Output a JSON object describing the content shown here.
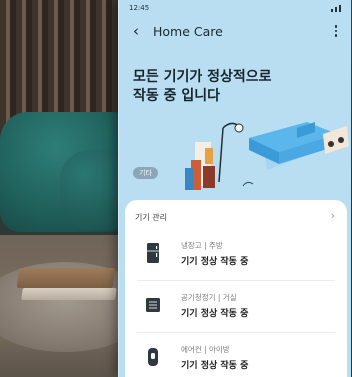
{
  "status_bar": {
    "time": "12:45"
  },
  "header": {
    "title": "Home Care"
  },
  "headline": [
    "모든 기기가 정상적으로",
    "작동 중 입니다"
  ],
  "hero": {
    "badge": "기타"
  },
  "devices_card": {
    "title": "기기 관리",
    "items": [
      {
        "location": "냉장고 | 주방",
        "status": "기기 정상 작동 중",
        "icon": "refrigerator-icon"
      },
      {
        "location": "공기청정기 | 거실",
        "status": "기기 정상 작동 중",
        "icon": "air-purifier-icon"
      },
      {
        "location": "에어컨 | 아이방",
        "status": "기기 정상 작동 중",
        "icon": "air-conditioner-icon"
      }
    ]
  },
  "colors": {
    "screen_bg": "#b9def2",
    "card_bg": "#ffffff",
    "text_dark": "#17242c"
  }
}
